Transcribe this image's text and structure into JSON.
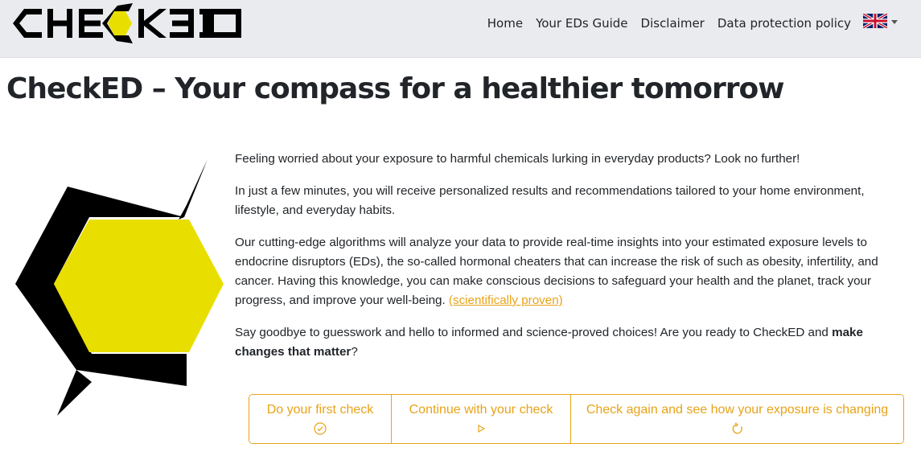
{
  "header": {
    "brand": "CHECKED",
    "nav": [
      {
        "label": "Home"
      },
      {
        "label": "Your EDs Guide"
      },
      {
        "label": "Disclaimer"
      },
      {
        "label": "Data protection policy"
      }
    ],
    "language_icon": "uk-flag-icon"
  },
  "main": {
    "title": "CheckED – Your compass for a healthier tomorrow",
    "paragraphs": {
      "p1": "Feeling worried about your exposure to harmful chemicals lurking in everyday products? Look no further!",
      "p2": "In just a few minutes, you will receive personalized results and recommendations tailored to your home environment, lifestyle, and everyday habits.",
      "p3_text": "Our cutting-edge algorithms will analyze your data to provide real-time insights into your estimated exposure levels to endocrine disruptors (EDs), the so-called hormonal cheaters that can increase the risk of such as obesity, infertility, and cancer. Having this knowledge, you can make conscious decisions to safeguard your health and the planet, track your progress, and improve your well-being. ",
      "p3_link": "(scientifically proven)",
      "p4_text": "Say goodbye to guesswork and hello to informed and science-proved choices! Are you ready to CheckED and ",
      "p4_bold": "make changes that matter",
      "p4_end": "?"
    },
    "buttons": [
      {
        "label": "Do your first check",
        "icon": "check-circle-icon"
      },
      {
        "label": "Continue with your check",
        "icon": "play-icon"
      },
      {
        "label": "Check again and see how your exposure is changing",
        "icon": "refresh-icon"
      }
    ]
  },
  "colors": {
    "accent": "#e8a318",
    "navbar_bg": "#e9ebef",
    "logo_yellow": "#e8df00",
    "logo_black": "#000000"
  }
}
